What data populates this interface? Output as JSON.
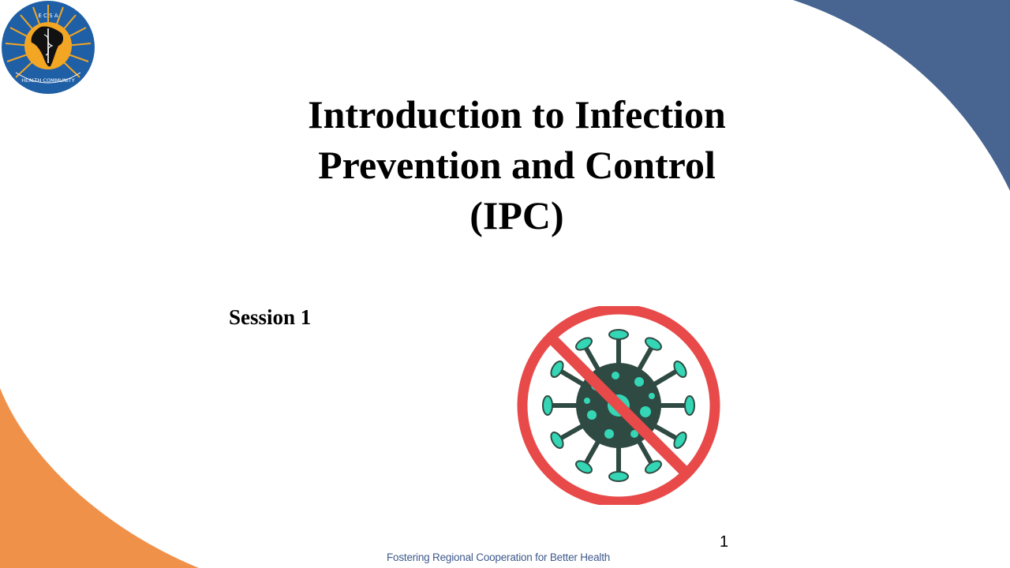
{
  "slide": {
    "title_lines": [
      "Introduction to Infection",
      "Prevention and Control",
      "(IPC)"
    ],
    "session_label": "Session 1",
    "page_number": "1",
    "footer_tagline": "Fostering Regional Cooperation for Better Health"
  },
  "logo": {
    "name": "ecsa-health-community-logo",
    "lettering": "ECSA HEALTH COMMUNITY"
  },
  "graphic": {
    "icon": "no-virus-icon"
  },
  "colors": {
    "top_right_shape": "#476590",
    "bottom_left_shape": "#f0914a",
    "prohibition_ring": "#e84a4a",
    "virus_body": "#2f4a42",
    "virus_accent": "#34d6b5",
    "footer_text": "#3e5a8c",
    "logo_blue": "#1f5fa6",
    "logo_gold": "#f3a623"
  }
}
